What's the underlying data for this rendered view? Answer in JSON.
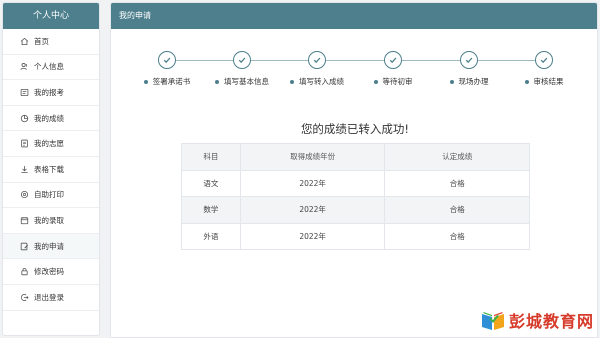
{
  "sidebar": {
    "title": "个人中心",
    "items": [
      {
        "label": "首页",
        "icon": "home-icon"
      },
      {
        "label": "个人信息",
        "icon": "user-icon"
      },
      {
        "label": "我的报考",
        "icon": "register-icon"
      },
      {
        "label": "我的成绩",
        "icon": "score-icon"
      },
      {
        "label": "我的志愿",
        "icon": "wish-icon"
      },
      {
        "label": "表格下载",
        "icon": "download-icon"
      },
      {
        "label": "自助打印",
        "icon": "print-icon"
      },
      {
        "label": "我的录取",
        "icon": "admission-icon"
      },
      {
        "label": "我的申请",
        "icon": "apply-icon"
      },
      {
        "label": "修改密码",
        "icon": "lock-icon"
      },
      {
        "label": "退出登录",
        "icon": "logout-icon"
      }
    ]
  },
  "main": {
    "title": "我的申请",
    "steps": [
      {
        "label": "签署承诺书",
        "status": "done"
      },
      {
        "label": "填写基本信息",
        "status": "done"
      },
      {
        "label": "填写转入成绩",
        "status": "done"
      },
      {
        "label": "等待初审",
        "status": "done"
      },
      {
        "label": "现场办理",
        "status": "done"
      },
      {
        "label": "审核结果",
        "status": "done"
      }
    ],
    "success_message": "您的成绩已转入成功!",
    "table": {
      "headers": [
        "科目",
        "取得成绩年份",
        "认定成绩"
      ],
      "rows": [
        [
          "语文",
          "2022年",
          "合格"
        ],
        [
          "数学",
          "2022年",
          "合格"
        ],
        [
          "外语",
          "2022年",
          "合格"
        ]
      ]
    }
  },
  "watermark": {
    "text": "彭城教育网"
  },
  "colors": {
    "accent": "#4d7f8c",
    "header_text": "#ffffff",
    "background": "#f0f2f4",
    "watermark": "#d63a2a"
  }
}
